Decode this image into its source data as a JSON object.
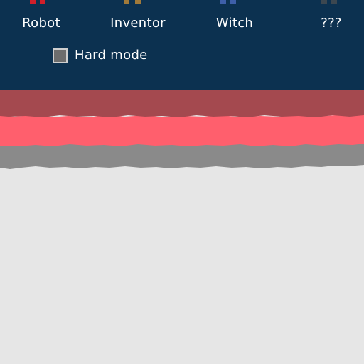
{
  "characters": [
    {
      "name": "Robot",
      "sprite_color": "#d11f2a",
      "icon": "robot-sprite-icon"
    },
    {
      "name": "Inventor",
      "sprite_color": "#a17a3a",
      "icon": "inventor-sprite-icon"
    },
    {
      "name": "Witch",
      "sprite_color": "#3e5fa8",
      "icon": "witch-sprite-icon"
    },
    {
      "name": "???",
      "sprite_color": "#3c4750",
      "icon": "mystery-sprite-icon"
    }
  ],
  "hard_mode": {
    "label": "Hard mode",
    "checked": false
  },
  "colors": {
    "panel": "#0c3150",
    "stripe_dark_red": "#a4494f",
    "stripe_red": "#ff5f6d",
    "stripe_gray": "#8a8a8a",
    "background": "#e6e6e6"
  }
}
